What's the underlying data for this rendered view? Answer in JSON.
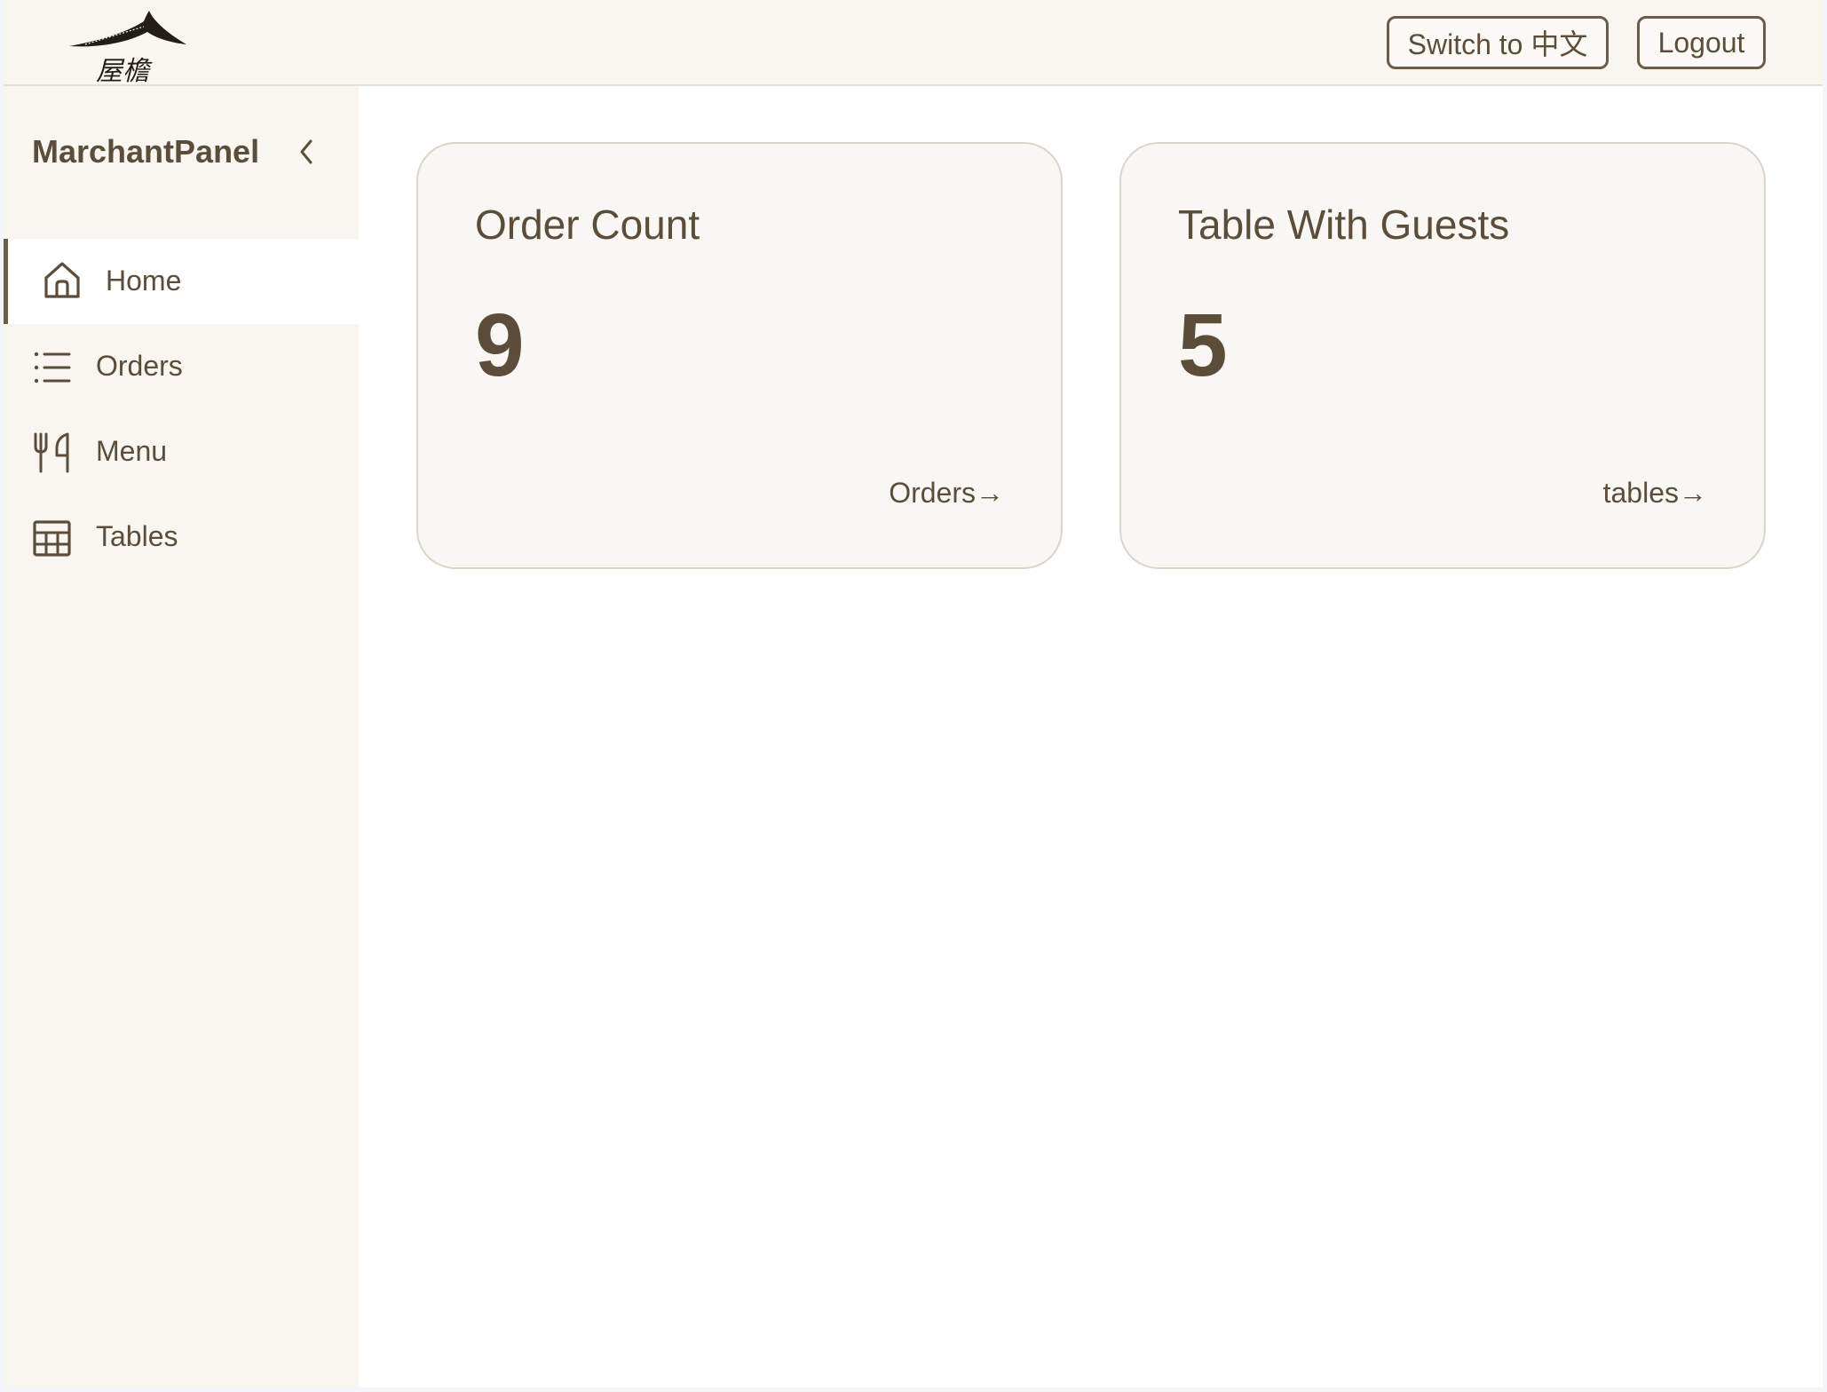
{
  "header": {
    "logo_text": "屋檐",
    "switch_language_label": "Switch to 中文",
    "logout_label": "Logout"
  },
  "sidebar": {
    "title": "MarchantPanel",
    "items": [
      {
        "label": "Home",
        "icon": "home-icon",
        "active": true
      },
      {
        "label": "Orders",
        "icon": "list-icon",
        "active": false
      },
      {
        "label": "Menu",
        "icon": "utensils-icon",
        "active": false
      },
      {
        "label": "Tables",
        "icon": "table-grid-icon",
        "active": false
      }
    ]
  },
  "cards": [
    {
      "title": "Order Count",
      "value": "9",
      "link": "Orders→"
    },
    {
      "title": "Table With Guests",
      "value": "5",
      "link": "tables→"
    }
  ],
  "colors": {
    "accent": "#6d5c48",
    "text": "#5c4d3a",
    "sidebar_bg": "#f9f6f1",
    "card_bg": "#f9f7f4",
    "card_border": "#ddd4c8"
  }
}
